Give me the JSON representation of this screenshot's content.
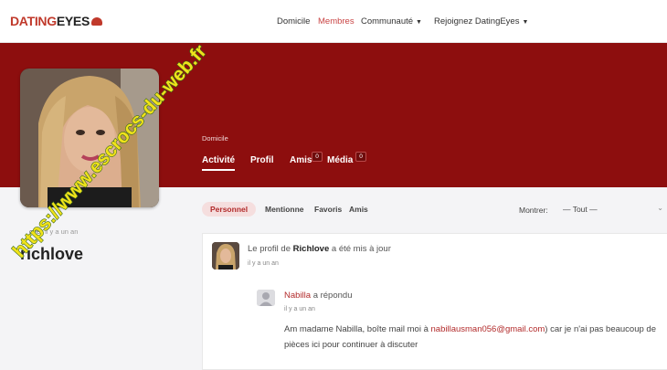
{
  "brand": {
    "dating": "DATING",
    "eyes": "EYES"
  },
  "nav": {
    "home": "Domicile",
    "members": "Membres",
    "community": "Communauté",
    "join": "Rejoignez DatingEyes"
  },
  "profile": {
    "breadcrumb": "Domicile",
    "tabs": [
      {
        "label": "Activité"
      },
      {
        "label": "Profil"
      },
      {
        "label": "Amis",
        "count": "0"
      },
      {
        "label": "Média",
        "count": "0"
      }
    ],
    "handle": "@richlove",
    "handle_partial": "ove",
    "last_active": "il y a un an",
    "username": "richlove"
  },
  "activity_filter": {
    "tabs": [
      "Personnel",
      "Mentionne",
      "Favoris",
      "Amis"
    ],
    "show_label": "Montrer:",
    "show_value": "— Tout —"
  },
  "feed": {
    "item": {
      "prefix": "Le profil de",
      "user": "Richlove",
      "suffix": "a été mis à jour",
      "time": "il y a un an"
    },
    "reply": {
      "name": "Nabilla",
      "action": "a répondu",
      "time": "il y a un an",
      "body_start": "Am madame Nabilla, boîte mail moi à",
      "email": "nabillausman056@gmail.com",
      "body_end": ") car je n'ai pas beaucoup de pièces ici pour continuer à discuter"
    }
  },
  "watermark": {
    "text": "https://www.escrocs-du-web.fr"
  },
  "colors": {
    "brand_red": "#c0392b",
    "banner": "#8d0e0e",
    "accent": "#b22b2b",
    "watermark_fill": "#f0e21a"
  }
}
